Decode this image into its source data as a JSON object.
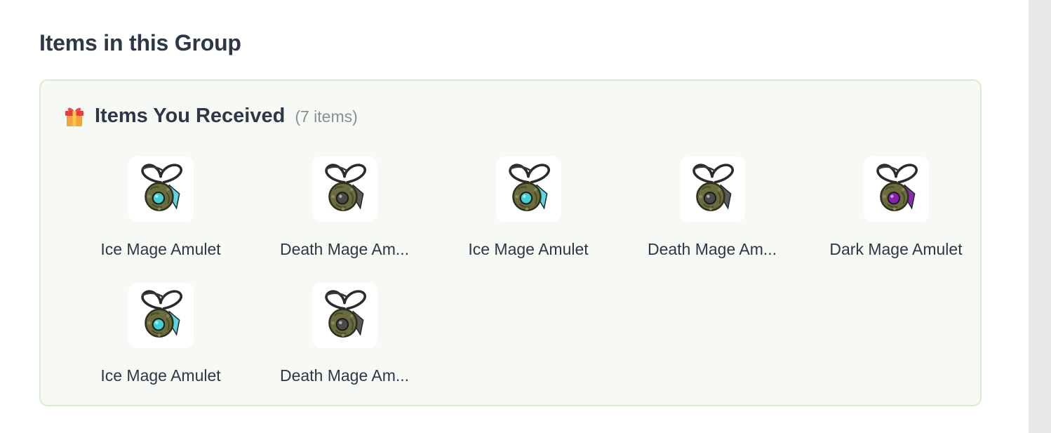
{
  "section_title": "Items in this Group",
  "panel": {
    "icon": "gift-icon",
    "title": "Items You Received",
    "count": "(7 items)"
  },
  "items": [
    {
      "name": "Ice Mage Amulet",
      "icon": "ice-mage-amulet-icon",
      "gem_color": "#3fd0d4",
      "feather_color": "#5fd6df"
    },
    {
      "name": "Death Mage Am...",
      "icon": "death-mage-amulet-icon",
      "gem_color": "#4a4a48",
      "feather_color": "#5b5b5b"
    },
    {
      "name": "Ice Mage Amulet",
      "icon": "ice-mage-amulet-icon",
      "gem_color": "#3fd0d4",
      "feather_color": "#5fd6df"
    },
    {
      "name": "Death Mage Am...",
      "icon": "death-mage-amulet-icon",
      "gem_color": "#4a4a48",
      "feather_color": "#5b5b5b"
    },
    {
      "name": "Dark Mage Amulet",
      "icon": "dark-mage-amulet-icon",
      "gem_color": "#8a1fb5",
      "feather_color": "#8d2ab3"
    },
    {
      "name": "Ice Mage Amulet",
      "icon": "ice-mage-amulet-icon",
      "gem_color": "#3fd0d4",
      "feather_color": "#5fd6df"
    },
    {
      "name": "Death Mage Am...",
      "icon": "death-mage-amulet-icon",
      "gem_color": "#4a4a48",
      "feather_color": "#5b5b5b"
    }
  ]
}
